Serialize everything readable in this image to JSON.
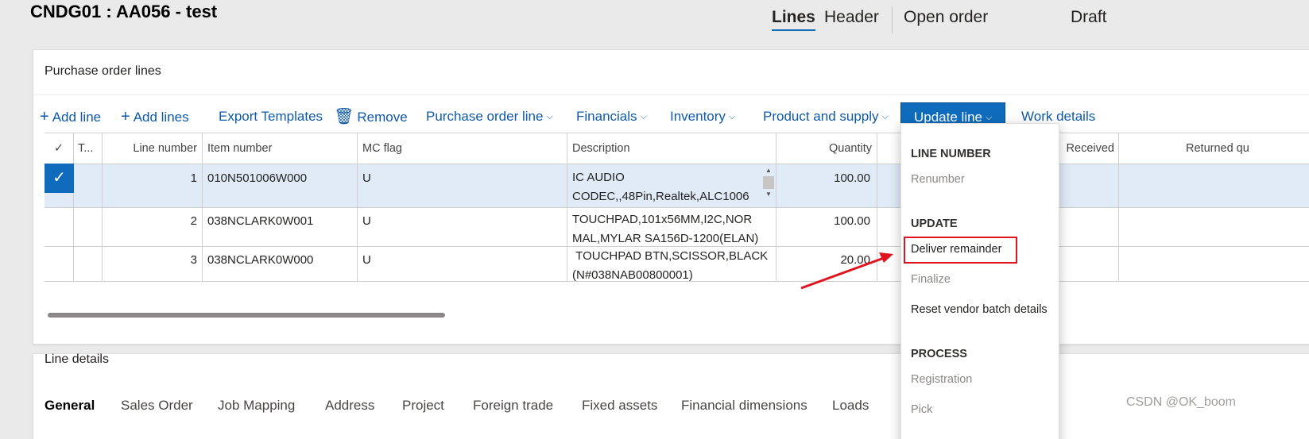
{
  "page": {
    "title": "CNDG01 : AA056 - test",
    "nav_tabs": [
      "Lines",
      "Header",
      "Open order",
      "Draft"
    ],
    "active_nav": "Lines"
  },
  "lines_panel": {
    "title": "Purchase order lines",
    "toolbar": {
      "add_line": "Add line",
      "add_lines": "Add lines",
      "export_templates": "Export Templates",
      "remove": "Remove",
      "purchase_order_line": "Purchase order line",
      "financials": "Financials",
      "inventory": "Inventory",
      "product_and_supply": "Product and supply",
      "update_line": "Update line",
      "work_details": "Work details"
    },
    "columns": [
      "T...",
      "Line number",
      "Item number",
      "MC flag",
      "Description",
      "Quantity",
      "Received",
      "Returned qu"
    ],
    "rows": [
      {
        "line": "1",
        "item": "010N501006W000",
        "mc": "U",
        "desc": "IC AUDIO CODEC,,48Pin,Realtek,ALC1006",
        "qty": "100.00",
        "selected": true
      },
      {
        "line": "2",
        "item": "038NCLARK0W001",
        "mc": "U",
        "desc": "TOUCHPAD,101x56MM,I2C,NOR MAL,MYLAR SA156D-1200(ELAN)",
        "qty": "100.00",
        "selected": false
      },
      {
        "line": "3",
        "item": "038NCLARK0W000",
        "mc": "U",
        "desc": " TOUCHPAD BTN,SCISSOR,BLACK (N#038NAB00800001)",
        "qty": "20.00",
        "selected": false
      }
    ]
  },
  "update_menu": {
    "sections": [
      {
        "header": "LINE NUMBER",
        "items": [
          {
            "label": "Renumber",
            "enabled": false
          }
        ]
      },
      {
        "header": "UPDATE",
        "items": [
          {
            "label": "Deliver remainder",
            "enabled": true,
            "highlighted": true
          },
          {
            "label": "Finalize",
            "enabled": false
          },
          {
            "label": "Reset vendor batch details",
            "enabled": true
          }
        ]
      },
      {
        "header": "PROCESS",
        "items": [
          {
            "label": "Registration",
            "enabled": false
          },
          {
            "label": "Pick",
            "enabled": false
          }
        ]
      }
    ]
  },
  "details_panel": {
    "title": "Line details",
    "tabs": [
      "General",
      "Sales Order",
      "Job Mapping",
      "Address",
      "Project",
      "Foreign trade",
      "Fixed assets",
      "Financial dimensions",
      "Loads"
    ],
    "active_tab": "General"
  },
  "watermark": "CSDN @OK_boom",
  "colors": {
    "accent": "#0f6cbd",
    "link": "#0f5aa8",
    "selected_row": "#e0ebf7",
    "annotation": "#e0141e"
  }
}
